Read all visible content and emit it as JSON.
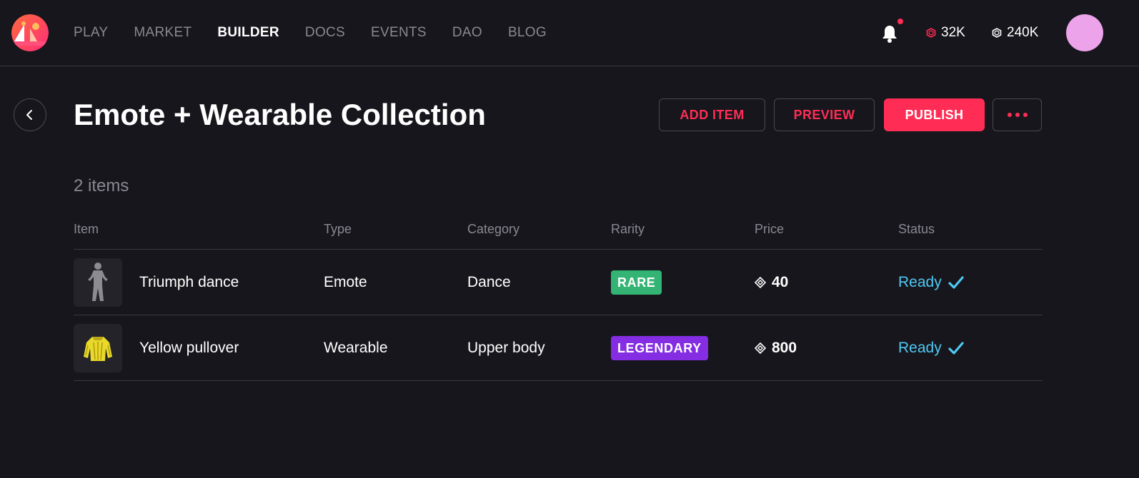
{
  "nav": {
    "items": [
      {
        "label": "PLAY",
        "active": false
      },
      {
        "label": "MARKET",
        "active": false
      },
      {
        "label": "BUILDER",
        "active": true
      },
      {
        "label": "DOCS",
        "active": false
      },
      {
        "label": "EVENTS",
        "active": false
      },
      {
        "label": "DAO",
        "active": false
      },
      {
        "label": "BLOG",
        "active": false
      }
    ],
    "balances": [
      {
        "icon": "mana-ethereum-icon",
        "value": "32K",
        "color": "#ff2d55"
      },
      {
        "icon": "mana-polygon-icon",
        "value": "240K",
        "color": "#ffffff"
      }
    ],
    "avatar_color": "#eda3ea"
  },
  "header": {
    "title": "Emote + Wearable Collection",
    "buttons": {
      "add_item": "ADD ITEM",
      "preview": "PREVIEW",
      "publish": "PUBLISH"
    }
  },
  "list": {
    "count_label": "2 items",
    "columns": [
      "Item",
      "Type",
      "Category",
      "Rarity",
      "Price",
      "Status"
    ],
    "rows": [
      {
        "thumbnail": "emote-figure-icon",
        "name": "Triumph dance",
        "type": "Emote",
        "category": "Dance",
        "rarity": "RARE",
        "rarity_color": "#34b474",
        "price": "40",
        "status": "Ready"
      },
      {
        "thumbnail": "pullover-icon",
        "name": "Yellow pullover",
        "type": "Wearable",
        "category": "Upper body",
        "rarity": "LEGENDARY",
        "rarity_color": "#842de3",
        "price": "800",
        "status": "Ready"
      }
    ]
  },
  "colors": {
    "background": "#17161c",
    "accent": "#ff2d55",
    "status_ready": "#4ec9f3"
  }
}
